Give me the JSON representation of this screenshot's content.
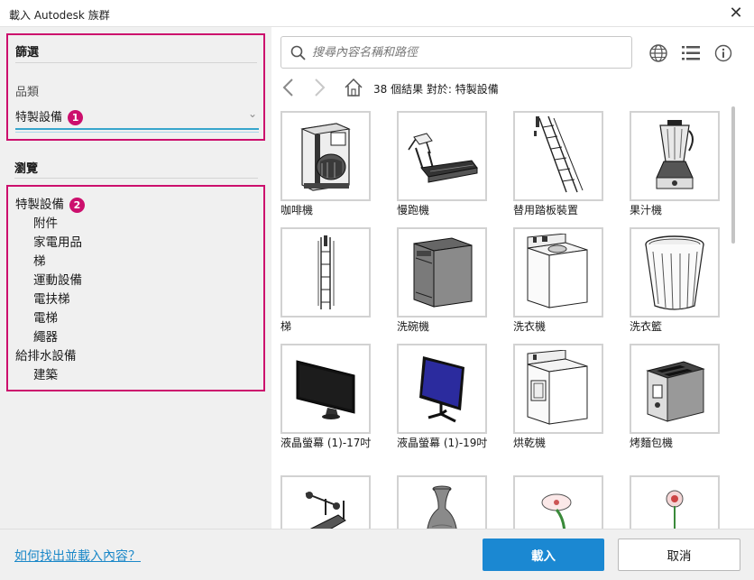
{
  "window": {
    "title": "載入 Autodesk 族群",
    "close_glyph": "✕"
  },
  "filter": {
    "heading": "篩選",
    "category_label": "品類",
    "selected_category": "特製設備",
    "badge": "1"
  },
  "browse": {
    "heading": "瀏覽",
    "badge": "2",
    "tree": [
      {
        "label": "特製設備",
        "level": 0
      },
      {
        "label": "附件",
        "level": 1
      },
      {
        "label": "家電用品",
        "level": 1
      },
      {
        "label": "梯",
        "level": 1
      },
      {
        "label": "運動設備",
        "level": 1
      },
      {
        "label": "電扶梯",
        "level": 1
      },
      {
        "label": "電梯",
        "level": 1
      },
      {
        "label": "繩器",
        "level": 1
      },
      {
        "label": "給排水設備",
        "level": 0
      },
      {
        "label": "建築",
        "level": 1
      }
    ]
  },
  "search": {
    "placeholder": "搜尋內容名稱和路徑",
    "icon": "search-icon"
  },
  "toolbar_icons": [
    "globe-icon",
    "list-view-icon",
    "info-icon"
  ],
  "nav": {
    "result_text": "38 個結果 對於: 特製設備",
    "icons": [
      "back-icon",
      "forward-icon",
      "home-icon"
    ]
  },
  "results": [
    {
      "label": "咖啡機",
      "thumb": "coffee-maker"
    },
    {
      "label": "慢跑機",
      "thumb": "treadmill"
    },
    {
      "label": "替用踏板裝置",
      "thumb": "ship-ladder"
    },
    {
      "label": "果汁機",
      "thumb": "blender"
    },
    {
      "label": "梯",
      "thumb": "fixed-ladder"
    },
    {
      "label": "洗碗機",
      "thumb": "dishwasher"
    },
    {
      "label": "洗衣機",
      "thumb": "washer"
    },
    {
      "label": "洗衣籃",
      "thumb": "laundry-basket"
    },
    {
      "label": "液晶螢幕 (1)-17吋",
      "thumb": "monitor-black"
    },
    {
      "label": "液晶螢幕 (1)-19吋",
      "thumb": "monitor-blue"
    },
    {
      "label": "烘乾機",
      "thumb": "dryer"
    },
    {
      "label": "烤麵包機",
      "thumb": "toaster"
    },
    {
      "label": "",
      "thumb": "weight-bench"
    },
    {
      "label": "",
      "thumb": "vase"
    },
    {
      "label": "",
      "thumb": "flower-plate"
    },
    {
      "label": "",
      "thumb": "flower-vase"
    }
  ],
  "footer": {
    "help_link": "如何找出並載入內容？",
    "load_button": "載入",
    "cancel_button": "取消"
  },
  "colors": {
    "highlight_border": "#cc0f6d",
    "primary_button": "#1b88d2",
    "link": "#1b88c8",
    "selection_underline": "#37a5cc",
    "monitor_screen_blue": "#2b2b9e"
  }
}
